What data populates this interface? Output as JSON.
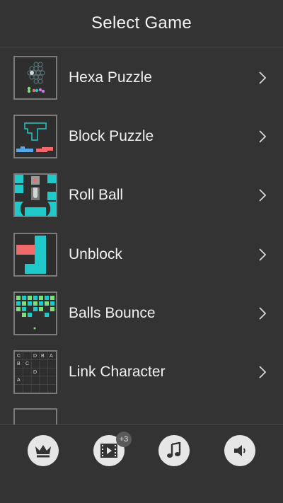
{
  "header": {
    "title": "Select Game"
  },
  "games": [
    {
      "label": "Hexa Puzzle",
      "thumb_icon": "hexa-puzzle-thumbnail"
    },
    {
      "label": "Block Puzzle",
      "thumb_icon": "block-puzzle-thumbnail"
    },
    {
      "label": "Roll Ball",
      "thumb_icon": "roll-ball-thumbnail"
    },
    {
      "label": "Unblock",
      "thumb_icon": "unblock-thumbnail"
    },
    {
      "label": "Balls Bounce",
      "thumb_icon": "balls-bounce-thumbnail"
    },
    {
      "label": "Link Character",
      "thumb_icon": "link-character-thumbnail"
    }
  ],
  "link_character_letters": [
    "C",
    "D",
    "B",
    "A",
    "B",
    "C",
    "D",
    "A"
  ],
  "footer": {
    "buttons": [
      {
        "icon": "crown-icon"
      },
      {
        "icon": "video-icon",
        "badge": "+3"
      },
      {
        "icon": "music-note-icon"
      },
      {
        "icon": "speaker-icon"
      }
    ]
  },
  "colors": {
    "background": "#333333",
    "teal": "#1fc9c9",
    "coral": "#f06a6a",
    "green": "#7ee07a",
    "button": "#e6e6e6"
  }
}
